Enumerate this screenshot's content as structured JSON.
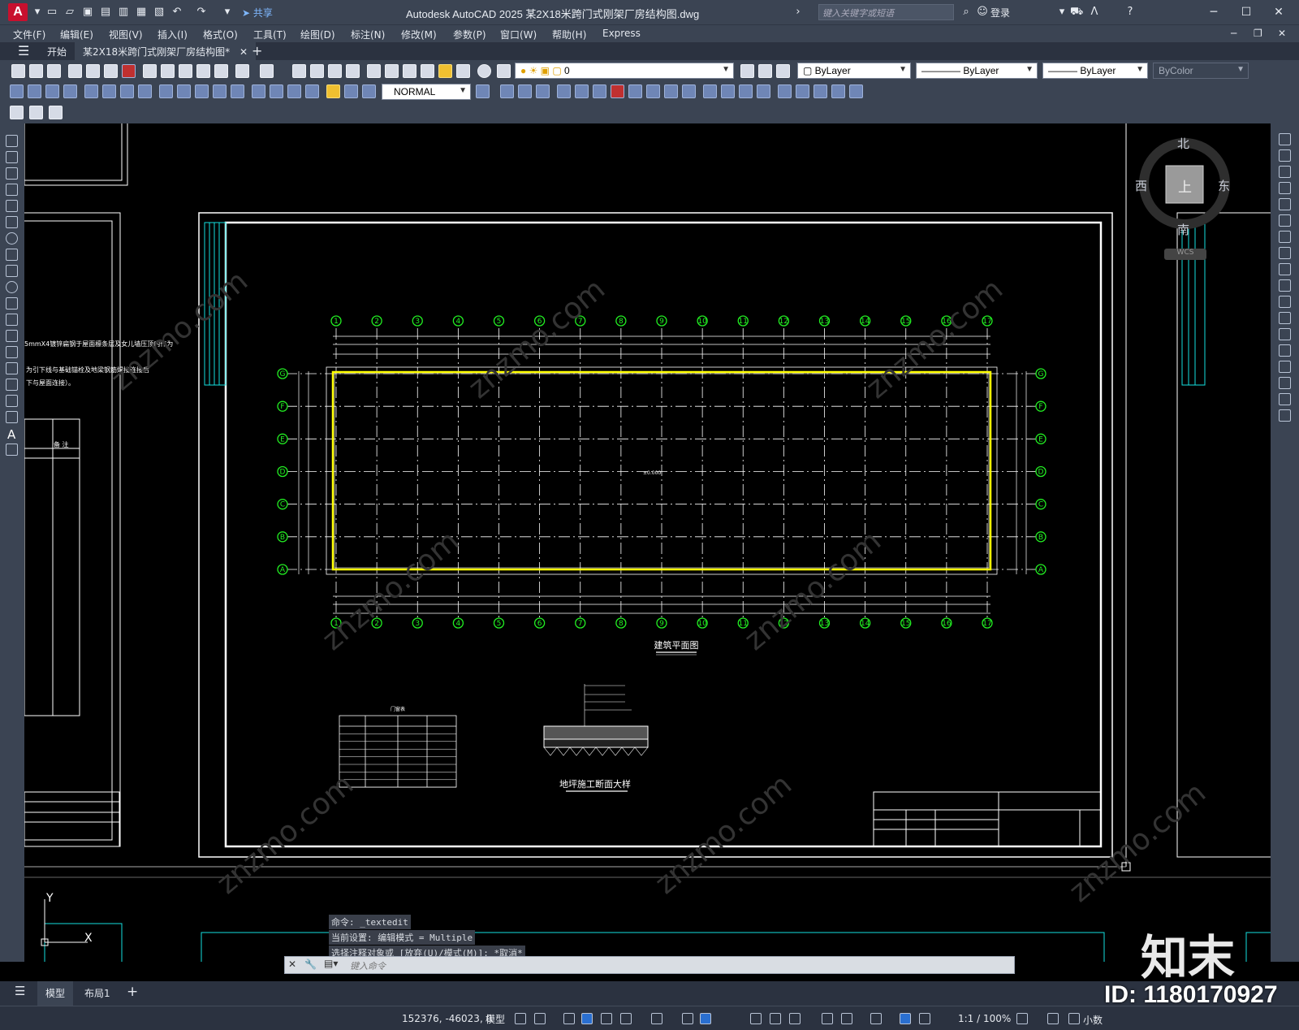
{
  "titlebar": {
    "logo": "A",
    "share": "共享",
    "title": "Autodesk AutoCAD 2025    某2X18米跨门式刚架厂房结构图.dwg",
    "search_placeholder": "键入关键字或短语",
    "login": "登录"
  },
  "menu": [
    "文件(F)",
    "编辑(E)",
    "视图(V)",
    "插入(I)",
    "格式(O)",
    "工具(T)",
    "绘图(D)",
    "标注(N)",
    "修改(M)",
    "参数(P)",
    "窗口(W)",
    "帮助(H)",
    "Express"
  ],
  "tabs": {
    "start": "开始",
    "active": "某2X18米跨门式刚架厂房结构图*",
    "add": "+"
  },
  "toolbar": {
    "layer_value": "0",
    "dimstyle": "NORMAL",
    "color": "ByLayer",
    "linetype": "ByLayer",
    "lineweight": "ByLayer",
    "plotstyle": "ByColor"
  },
  "viewcube": {
    "north": "北",
    "south": "南",
    "east": "东",
    "west": "西",
    "face": "上",
    "wcs": "WCS"
  },
  "drawing": {
    "plan_title": "建筑平面图",
    "section_title": "地坪施工断面大样",
    "schedule_title": "门窗表",
    "axis_numbers": [
      "1",
      "2",
      "3",
      "4",
      "5",
      "6",
      "7",
      "8",
      "9",
      "10",
      "11",
      "12",
      "13",
      "14",
      "15",
      "16",
      "17"
    ],
    "axis_letters": [
      "G",
      "F",
      "E",
      "D",
      "C",
      "B",
      "A"
    ],
    "left_note_1": "5mmX4镀锌扁钢于屋面檩条层及女儿墙压顶内作为",
    "left_note_2": "为引下线与基础锚栓及地梁钢筋焊接连接后",
    "left_note_3": "下与屋面连接）。",
    "left_table_header": "备 注",
    "elevation": "±0.000",
    "ucs_y": "Y",
    "ucs_x": "X"
  },
  "command": {
    "line1": "命令: _textedit",
    "line2": "当前设置: 编辑模式 = Multiple",
    "line3": "选择注释对象或 [放弃(U)/模式(M)]: *取消*",
    "placeholder": "键入命令"
  },
  "bottom_tabs": {
    "model": "模型",
    "layout1": "布局1",
    "add": "+"
  },
  "status": {
    "coords": "152376, -46023, 0",
    "model": "模型",
    "scale": "1:1 / 100%",
    "units": "小数"
  },
  "watermark": {
    "logo": "知末",
    "id": "ID: 1180170927"
  },
  "colors": {
    "chrome": "#3b4453",
    "canvas": "#000000",
    "axis_green": "#22ee22",
    "wall_yellow": "#ffff00",
    "frame_cyan": "#15e0e0"
  }
}
